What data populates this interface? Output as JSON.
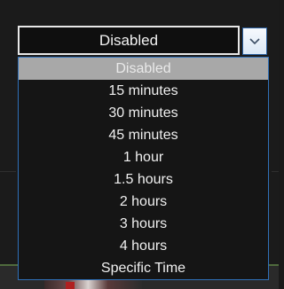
{
  "select": {
    "value": "Disabled",
    "arrow_icon": "chevron-down-icon"
  },
  "options": [
    {
      "label": "Disabled",
      "selected": true
    },
    {
      "label": "15 minutes",
      "selected": false
    },
    {
      "label": "30 minutes",
      "selected": false
    },
    {
      "label": "45 minutes",
      "selected": false
    },
    {
      "label": "1 hour",
      "selected": false
    },
    {
      "label": "1.5 hours",
      "selected": false
    },
    {
      "label": "2 hours",
      "selected": false
    },
    {
      "label": "3 hours",
      "selected": false
    },
    {
      "label": "4 hours",
      "selected": false
    },
    {
      "label": "Specific Time",
      "selected": false
    }
  ],
  "colors": {
    "highlight": "#a8a8a8",
    "dropdown_border": "#2f70b8",
    "accent_green": "#4f6b3d"
  }
}
